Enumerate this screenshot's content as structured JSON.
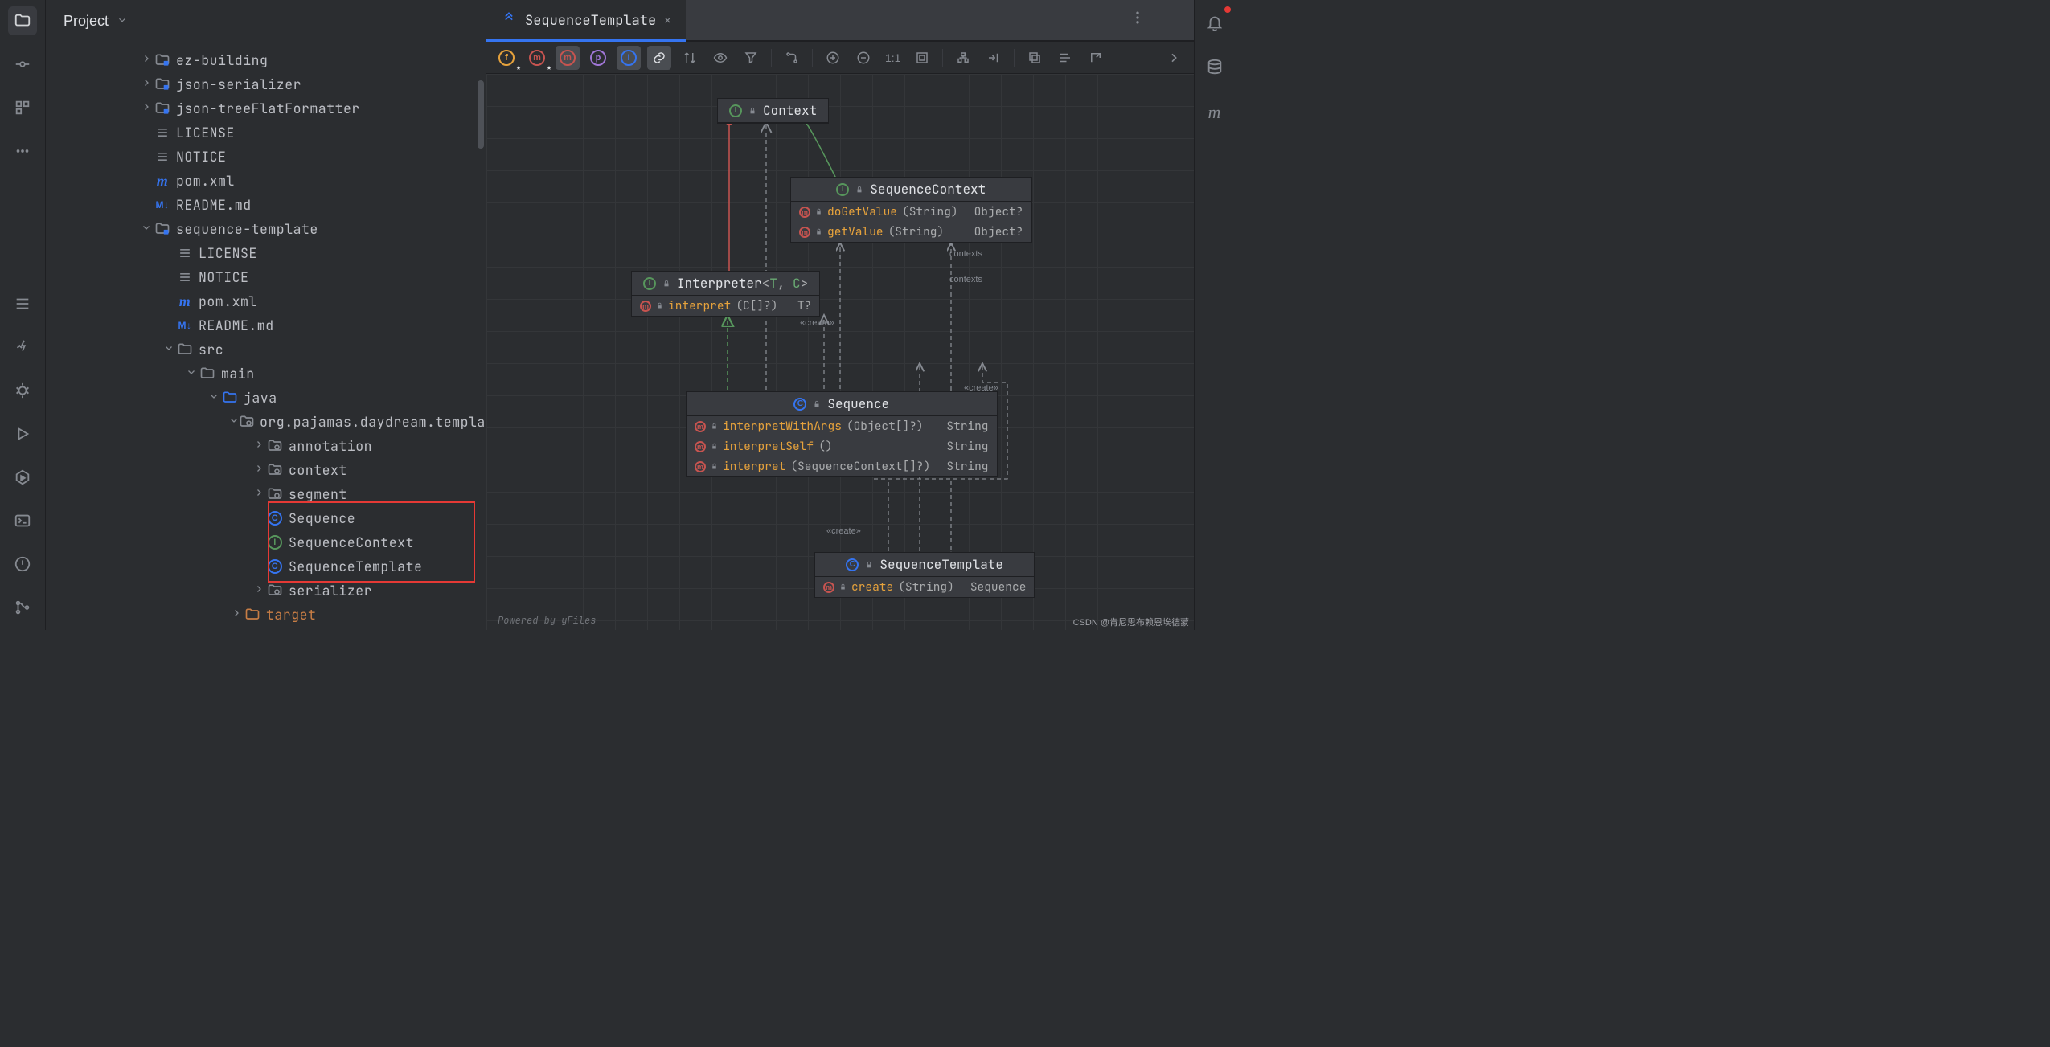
{
  "sidebar": {
    "title": "Project"
  },
  "tree": {
    "nodes": [
      {
        "depth": 0,
        "arrow": "right",
        "iconType": "module",
        "label": "ez-building",
        "name": "tree-ez-building"
      },
      {
        "depth": 0,
        "arrow": "right",
        "iconType": "module",
        "label": "json-serializer",
        "name": "tree-json-serializer"
      },
      {
        "depth": 0,
        "arrow": "right",
        "iconType": "module",
        "label": "json-treeFlatFormatter",
        "name": "tree-json-treeflat"
      },
      {
        "depth": 0,
        "arrow": "",
        "iconType": "file-text",
        "label": "LICENSE",
        "name": "tree-license-1"
      },
      {
        "depth": 0,
        "arrow": "",
        "iconType": "file-text",
        "label": "NOTICE",
        "name": "tree-notice-1"
      },
      {
        "depth": 0,
        "arrow": "",
        "iconType": "maven",
        "label": "pom.xml",
        "name": "tree-pom-1"
      },
      {
        "depth": 0,
        "arrow": "",
        "iconType": "md",
        "label": "README.md",
        "name": "tree-readme-1"
      },
      {
        "depth": 0,
        "arrow": "down",
        "iconType": "module",
        "label": "sequence-template",
        "name": "tree-sequence-template"
      },
      {
        "depth": 1,
        "arrow": "",
        "iconType": "file-text",
        "label": "LICENSE",
        "name": "tree-license-2"
      },
      {
        "depth": 1,
        "arrow": "",
        "iconType": "file-text",
        "label": "NOTICE",
        "name": "tree-notice-2"
      },
      {
        "depth": 1,
        "arrow": "",
        "iconType": "maven",
        "label": "pom.xml",
        "name": "tree-pom-2"
      },
      {
        "depth": 1,
        "arrow": "",
        "iconType": "md",
        "label": "README.md",
        "name": "tree-readme-2"
      },
      {
        "depth": 1,
        "arrow": "down",
        "iconType": "folder",
        "label": "src",
        "name": "tree-src"
      },
      {
        "depth": 2,
        "arrow": "down",
        "iconType": "folder",
        "label": "main",
        "name": "tree-main"
      },
      {
        "depth": 3,
        "arrow": "down",
        "iconType": "folder-src",
        "label": "java",
        "name": "tree-java"
      },
      {
        "depth": 4,
        "arrow": "down",
        "iconType": "package",
        "label": "org.pajamas.daydream.template",
        "name": "tree-package"
      },
      {
        "depth": 5,
        "arrow": "right",
        "iconType": "package",
        "label": "annotation",
        "name": "tree-annotation"
      },
      {
        "depth": 5,
        "arrow": "right",
        "iconType": "package",
        "label": "context",
        "name": "tree-context"
      },
      {
        "depth": 5,
        "arrow": "right",
        "iconType": "package",
        "label": "segment",
        "name": "tree-segment"
      },
      {
        "depth": 5,
        "arrow": "",
        "iconType": "class",
        "label": "Sequence",
        "name": "tree-sequence"
      },
      {
        "depth": 5,
        "arrow": "",
        "iconType": "interface",
        "label": "SequenceContext",
        "name": "tree-sequencecontext"
      },
      {
        "depth": 5,
        "arrow": "",
        "iconType": "class",
        "label": "SequenceTemplate",
        "name": "tree-sequencetemplate"
      },
      {
        "depth": 5,
        "arrow": "right",
        "iconType": "package",
        "label": "serializer",
        "name": "tree-serializer"
      },
      {
        "depth": 4,
        "arrow": "right",
        "iconType": "folder-excl",
        "label": "target",
        "name": "tree-target",
        "dim": true
      }
    ]
  },
  "tabs": {
    "active": {
      "label": "SequenceTemplate",
      "icon": "uml-diagram"
    }
  },
  "toolbar": {
    "circles": [
      "f",
      "m",
      "m",
      "p",
      "i"
    ],
    "zoom_label": "1:1"
  },
  "uml": {
    "context": {
      "name": "Context",
      "icon": "interface"
    },
    "seqcontext": {
      "name": "SequenceContext",
      "icon": "interface",
      "methods": [
        {
          "name": "doGetValue",
          "params": "(String)",
          "ret": "Object?"
        },
        {
          "name": "getValue",
          "params": "(String)",
          "ret": "Object?"
        }
      ]
    },
    "interpreter": {
      "name": "Interpreter",
      "generic": "<T, C>",
      "icon": "interface",
      "methods": [
        {
          "name": "interpret",
          "params": "(C[]?)",
          "ret": "T?"
        }
      ]
    },
    "sequence": {
      "name": "Sequence",
      "icon": "class",
      "methods": [
        {
          "name": "interpretWithArgs",
          "params": "(Object[]?)",
          "ret": "String"
        },
        {
          "name": "interpretSelf",
          "params": "()",
          "ret": "String"
        },
        {
          "name": "interpret",
          "params": "(SequenceContext[]?)",
          "ret": "String"
        }
      ]
    },
    "seqtemplate": {
      "name": "SequenceTemplate",
      "icon": "class",
      "methods": [
        {
          "name": "create",
          "params": "(String)",
          "ret": "Sequence"
        }
      ]
    },
    "annotations": {
      "contexts": "contexts",
      "create": "«create»"
    }
  },
  "footer": {
    "powered": "Powered by yFiles",
    "watermark": "CSDN @肯尼思布赖恩埃德蒙"
  }
}
